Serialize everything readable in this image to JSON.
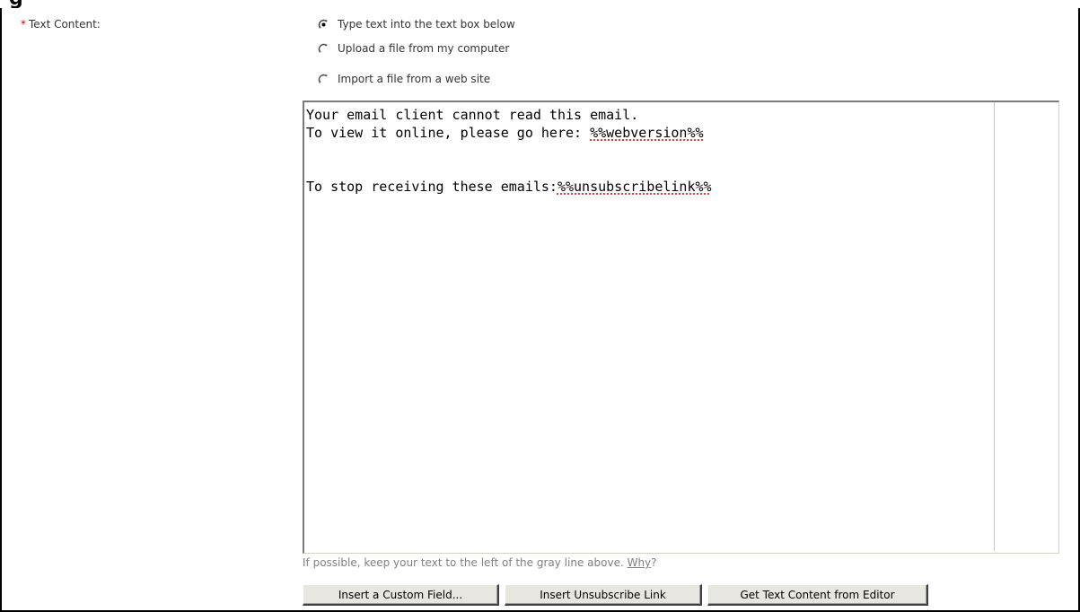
{
  "form": {
    "field_label": "Text Content:",
    "required_marker": "*",
    "source_options": [
      {
        "label": "Type text into the text box below",
        "selected": true
      },
      {
        "label": "Upload a file from my computer",
        "selected": false
      },
      {
        "label": "Import a file from a web site",
        "selected": false
      }
    ]
  },
  "editor": {
    "line1": "Your email client cannot read this email.",
    "line2_prefix": "To view it online, please go here: ",
    "line2_tag": "%%webversion%%",
    "line3_prefix": "To stop receiving these emails:",
    "line3_tag": "%%unsubscribelink%%"
  },
  "hint": {
    "text": "If possible, keep your text to the left of the gray line above. ",
    "link": "Why",
    "suffix": "?"
  },
  "buttons": {
    "insert_custom_field": "Insert a Custom Field...",
    "insert_unsubscribe": "Insert Unsubscribe Link",
    "get_text_content": "Get Text Content from Editor"
  },
  "colors": {
    "required": "#d40000",
    "hint_text": "#808080",
    "button_face": "#e8e6e1"
  }
}
